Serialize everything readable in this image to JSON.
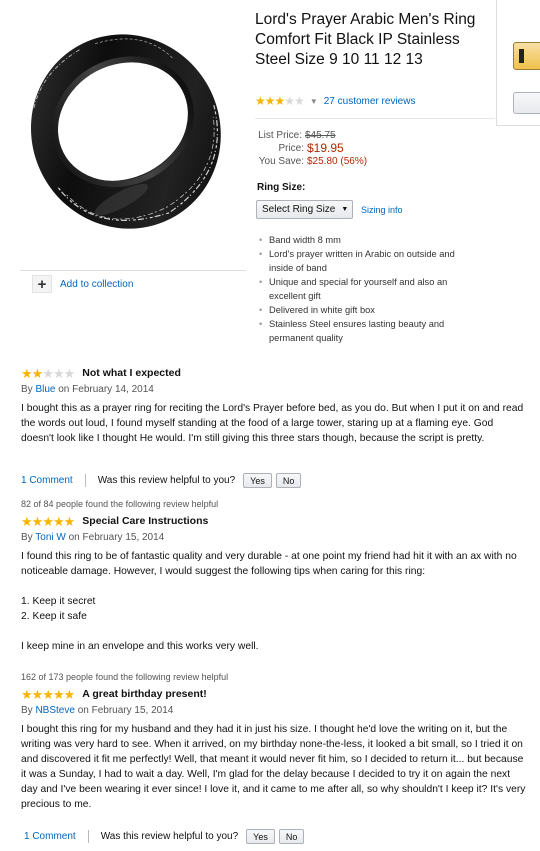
{
  "product": {
    "title": "Lord's Prayer Arabic Men's Ring Comfort Fit Black IP Stainless Steel Size 9 10 11 12 13",
    "rating": 3,
    "rating_max": 5,
    "reviews_link": "27 customer reviews",
    "list_price_label": "List Price:",
    "list_price": "$45.75",
    "price_label": "Price:",
    "price": "$19.95",
    "save_label": "You Save:",
    "save_value": "$25.80 (56%)",
    "ring_size_label": "Ring Size:",
    "size_select_value": "Select Ring Size",
    "sizing_info": "Sizing info",
    "add_to_collection": "Add to collection",
    "bullets": [
      "Band width 8 mm",
      "Lord's prayer written in Arabic on outside and inside of band",
      "Unique and special for yourself and also an excellent gift",
      "Delivered in white gift box",
      "Stainless Steel ensures lasting beauty and permanent quality"
    ],
    "colors": {
      "star": "#f7b500",
      "link": "#0066c0",
      "price": "#b12704"
    }
  },
  "reviews": [
    {
      "helpful_count": "",
      "rating": 2,
      "title": "Not what I expected",
      "by_prefix": "By",
      "author": "Blue",
      "date": "on February 14, 2014",
      "paragraphs": [
        "I bought this as a prayer ring for reciting the Lord's Prayer before bed, as you do. But when I put it on and read the words out loud, I found myself standing at the food of a large tower, staring up at a flaming eye. God doesn't look like I thought He would. I'm still giving this three stars though, because the script is pretty."
      ],
      "comments": "1 Comment",
      "helpful_question": "Was this review helpful to you?",
      "yes": "Yes",
      "no": "No"
    },
    {
      "helpful_count": "82 of 84 people found the following review helpful",
      "rating": 5,
      "title": "Special Care Instructions",
      "by_prefix": "By",
      "author": "Toni W",
      "date": "on February 15, 2014",
      "paragraphs": [
        "I found this ring to be of fantastic quality and very durable - at one point my friend had hit it with an ax with no noticeable damage. However, I would suggest the following tips when caring for this ring:",
        "1. Keep it secret\n2. Keep it safe",
        "I keep mine in an envelope and this works very well."
      ]
    },
    {
      "helpful_count": "162 of 173 people found the following review helpful",
      "rating": 5,
      "title": "A great birthday present!",
      "by_prefix": "By",
      "author": "NBSteve",
      "date": "on February 15, 2014",
      "paragraphs": [
        "I bought this ring for my husband and they had it in just his size. I thought he'd love the writing on it, but the writing was very hard to see. When it arrived, on my birthday none-the-less, it looked a bit small, so I tried it on and discovered it fit me perfectly! Well, that meant it would never fit him, so I decided to return it... but because it was a Sunday, I had to wait a day. Well, I'm glad for the delay because I decided to try it on again the next day and I've been wearing it ever since! I love it, and it came to me after all, so why shouldn't I keep it? It's very precious to me."
      ],
      "comments": "1 Comment",
      "helpful_question": "Was this review helpful to you?",
      "yes": "Yes",
      "no": "No"
    }
  ]
}
